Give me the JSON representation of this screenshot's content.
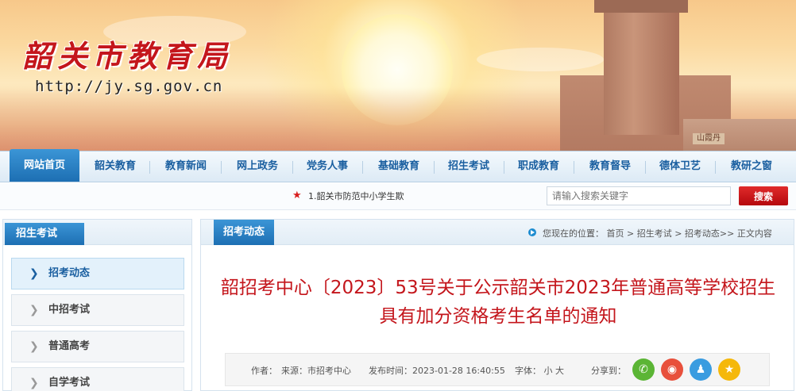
{
  "header": {
    "site_title": "韶关市教育局",
    "site_url": "http://jy.sg.gov.cn",
    "tower_sign": "",
    "wall_plaque": "山霞丹"
  },
  "nav": {
    "items": [
      {
        "label": "网站首页",
        "active": true
      },
      {
        "label": "韶关教育"
      },
      {
        "label": "教育新闻"
      },
      {
        "label": "网上政务"
      },
      {
        "label": "党务人事"
      },
      {
        "label": "基础教育"
      },
      {
        "label": "招生考试"
      },
      {
        "label": "职成教育"
      },
      {
        "label": "教育督导"
      },
      {
        "label": "德体卫艺"
      },
      {
        "label": "教研之窗"
      }
    ]
  },
  "subbar": {
    "marquee": "1.韶关市防范中小学生欺",
    "search_placeholder": "请输入搜索关键字",
    "search_button": "搜索"
  },
  "sidebar": {
    "title": "招生考试",
    "items": [
      {
        "label": "招考动态",
        "active": true
      },
      {
        "label": "中招考试"
      },
      {
        "label": "普通高考"
      },
      {
        "label": "自学考试"
      }
    ]
  },
  "main": {
    "tab": "招考动态",
    "breadcrumb": {
      "prefix": "您现在的位置：",
      "path": "首页 > 招生考试 > 招考动态>> 正文内容"
    },
    "article_title": "韶招考中心〔2023〕53号关于公示韶关市2023年普通高等学校招生具有加分资格考生名单的通知",
    "meta": {
      "author": "作者：",
      "source": "来源：市招考中心",
      "time": "发布时间：2023-01-28 16:40:55",
      "font": "字体： 小  大",
      "share": "分享到："
    },
    "share_icons": [
      {
        "name": "wechat-icon",
        "color": "#5bb535",
        "glyph": "✆"
      },
      {
        "name": "weibo-icon",
        "color": "#e8503c",
        "glyph": "◉"
      },
      {
        "name": "qq-icon",
        "color": "#3a9ce0",
        "glyph": "♟"
      },
      {
        "name": "qzone-icon",
        "color": "#f5b80b",
        "glyph": "★"
      }
    ]
  }
}
